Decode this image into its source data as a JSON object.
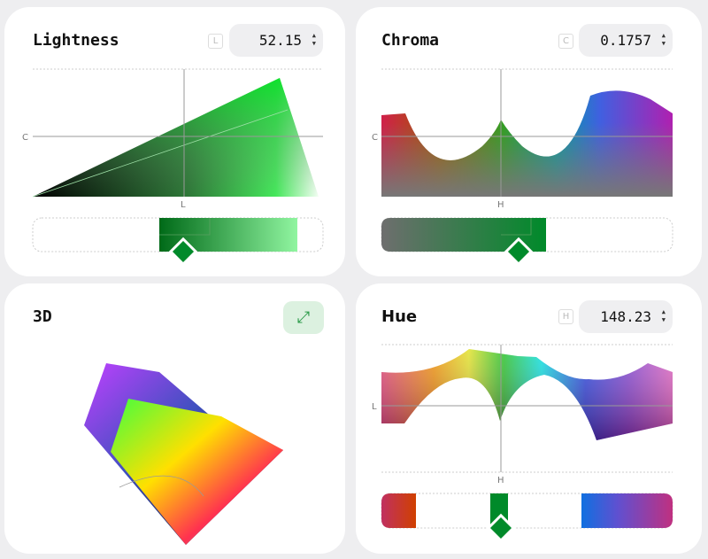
{
  "lightness": {
    "title": "Lightness",
    "badge": "L",
    "value": "52.15",
    "axis_x": "L",
    "axis_y": "C",
    "slider_percent": 52.15
  },
  "chroma": {
    "title": "Chroma",
    "badge": "C",
    "value": "0.1757",
    "axis_x": "H",
    "axis_y": "C"
  },
  "view3d": {
    "title": "3D",
    "expand_icon": "expand-arrows-icon"
  },
  "hue": {
    "title": "Hue",
    "badge": "H",
    "value": "148.23",
    "axis_x": "H",
    "axis_y": "L"
  },
  "colors": {
    "current": "#008a2a",
    "background": "#eeeef0",
    "expand_bg": "#dcf1e0"
  }
}
